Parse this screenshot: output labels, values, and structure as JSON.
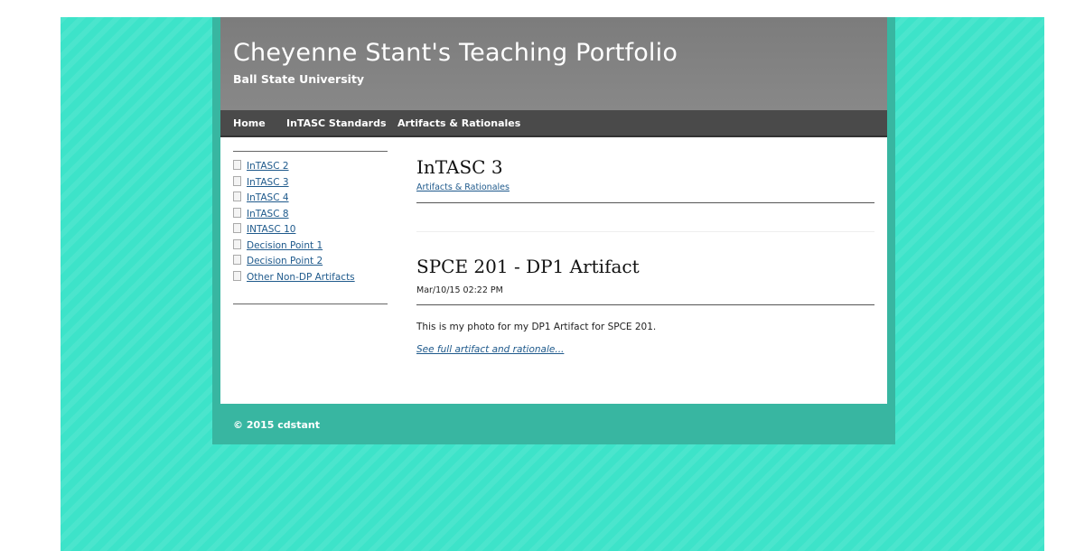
{
  "site": {
    "title": "Cheyenne Stant's Teaching Portfolio",
    "subtitle": "Ball State University"
  },
  "nav": {
    "items": [
      {
        "label": "Home"
      },
      {
        "label": "InTASC Standards"
      },
      {
        "label": "Artifacts & Rationales"
      }
    ]
  },
  "sidebar": {
    "items": [
      {
        "label": "InTASC 2",
        "icon": "page-icon"
      },
      {
        "label": "InTASC 3",
        "icon": "page-icon"
      },
      {
        "label": "InTASC 4",
        "icon": "page-icon"
      },
      {
        "label": "InTASC 8",
        "icon": "page-icon"
      },
      {
        "label": "INTASC 10",
        "icon": "page-icon"
      },
      {
        "label": "Decision Point 1",
        "icon": "page-icon"
      },
      {
        "label": "Decision Point 2",
        "icon": "page-icon"
      },
      {
        "label": "Other Non-DP Artifacts",
        "icon": "page-icon"
      }
    ]
  },
  "main": {
    "heading": "InTASC 3",
    "breadcrumb": "Artifacts & Rationales",
    "post": {
      "title": "SPCE 201 - DP1 Artifact",
      "date": "Mar/10/15 02:22 PM",
      "body": "This is my photo for my DP1 Artifact for SPCE 201.",
      "more_link": "See full artifact and rationale..."
    }
  },
  "footer": {
    "text": "© 2015 cdstant"
  },
  "colors": {
    "background": "#3de3c9",
    "wrapper": "#38b6a1",
    "header": "#808080",
    "nav": "#4a4a4a",
    "link": "#1f5a8c"
  }
}
